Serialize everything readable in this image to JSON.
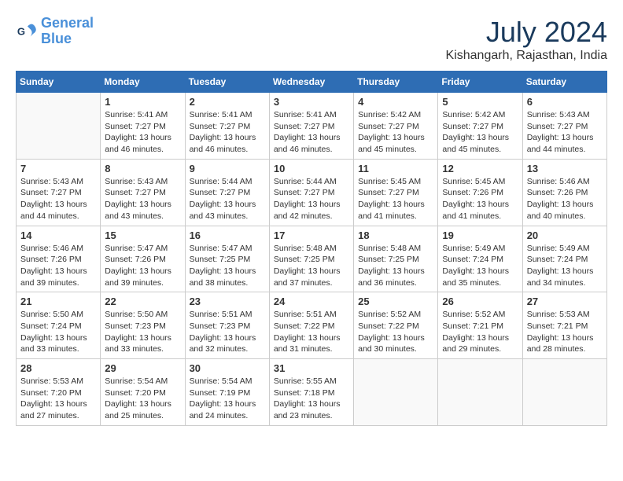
{
  "header": {
    "logo_line1": "General",
    "logo_line2": "Blue",
    "month_year": "July 2024",
    "location": "Kishangarh, Rajasthan, India"
  },
  "columns": [
    "Sunday",
    "Monday",
    "Tuesday",
    "Wednesday",
    "Thursday",
    "Friday",
    "Saturday"
  ],
  "weeks": [
    [
      {
        "day": "",
        "info": ""
      },
      {
        "day": "1",
        "info": "Sunrise: 5:41 AM\nSunset: 7:27 PM\nDaylight: 13 hours\nand 46 minutes."
      },
      {
        "day": "2",
        "info": "Sunrise: 5:41 AM\nSunset: 7:27 PM\nDaylight: 13 hours\nand 46 minutes."
      },
      {
        "day": "3",
        "info": "Sunrise: 5:41 AM\nSunset: 7:27 PM\nDaylight: 13 hours\nand 46 minutes."
      },
      {
        "day": "4",
        "info": "Sunrise: 5:42 AM\nSunset: 7:27 PM\nDaylight: 13 hours\nand 45 minutes."
      },
      {
        "day": "5",
        "info": "Sunrise: 5:42 AM\nSunset: 7:27 PM\nDaylight: 13 hours\nand 45 minutes."
      },
      {
        "day": "6",
        "info": "Sunrise: 5:43 AM\nSunset: 7:27 PM\nDaylight: 13 hours\nand 44 minutes."
      }
    ],
    [
      {
        "day": "7",
        "info": "Sunrise: 5:43 AM\nSunset: 7:27 PM\nDaylight: 13 hours\nand 44 minutes."
      },
      {
        "day": "8",
        "info": "Sunrise: 5:43 AM\nSunset: 7:27 PM\nDaylight: 13 hours\nand 43 minutes."
      },
      {
        "day": "9",
        "info": "Sunrise: 5:44 AM\nSunset: 7:27 PM\nDaylight: 13 hours\nand 43 minutes."
      },
      {
        "day": "10",
        "info": "Sunrise: 5:44 AM\nSunset: 7:27 PM\nDaylight: 13 hours\nand 42 minutes."
      },
      {
        "day": "11",
        "info": "Sunrise: 5:45 AM\nSunset: 7:27 PM\nDaylight: 13 hours\nand 41 minutes."
      },
      {
        "day": "12",
        "info": "Sunrise: 5:45 AM\nSunset: 7:26 PM\nDaylight: 13 hours\nand 41 minutes."
      },
      {
        "day": "13",
        "info": "Sunrise: 5:46 AM\nSunset: 7:26 PM\nDaylight: 13 hours\nand 40 minutes."
      }
    ],
    [
      {
        "day": "14",
        "info": "Sunrise: 5:46 AM\nSunset: 7:26 PM\nDaylight: 13 hours\nand 39 minutes."
      },
      {
        "day": "15",
        "info": "Sunrise: 5:47 AM\nSunset: 7:26 PM\nDaylight: 13 hours\nand 39 minutes."
      },
      {
        "day": "16",
        "info": "Sunrise: 5:47 AM\nSunset: 7:25 PM\nDaylight: 13 hours\nand 38 minutes."
      },
      {
        "day": "17",
        "info": "Sunrise: 5:48 AM\nSunset: 7:25 PM\nDaylight: 13 hours\nand 37 minutes."
      },
      {
        "day": "18",
        "info": "Sunrise: 5:48 AM\nSunset: 7:25 PM\nDaylight: 13 hours\nand 36 minutes."
      },
      {
        "day": "19",
        "info": "Sunrise: 5:49 AM\nSunset: 7:24 PM\nDaylight: 13 hours\nand 35 minutes."
      },
      {
        "day": "20",
        "info": "Sunrise: 5:49 AM\nSunset: 7:24 PM\nDaylight: 13 hours\nand 34 minutes."
      }
    ],
    [
      {
        "day": "21",
        "info": "Sunrise: 5:50 AM\nSunset: 7:24 PM\nDaylight: 13 hours\nand 33 minutes."
      },
      {
        "day": "22",
        "info": "Sunrise: 5:50 AM\nSunset: 7:23 PM\nDaylight: 13 hours\nand 33 minutes."
      },
      {
        "day": "23",
        "info": "Sunrise: 5:51 AM\nSunset: 7:23 PM\nDaylight: 13 hours\nand 32 minutes."
      },
      {
        "day": "24",
        "info": "Sunrise: 5:51 AM\nSunset: 7:22 PM\nDaylight: 13 hours\nand 31 minutes."
      },
      {
        "day": "25",
        "info": "Sunrise: 5:52 AM\nSunset: 7:22 PM\nDaylight: 13 hours\nand 30 minutes."
      },
      {
        "day": "26",
        "info": "Sunrise: 5:52 AM\nSunset: 7:21 PM\nDaylight: 13 hours\nand 29 minutes."
      },
      {
        "day": "27",
        "info": "Sunrise: 5:53 AM\nSunset: 7:21 PM\nDaylight: 13 hours\nand 28 minutes."
      }
    ],
    [
      {
        "day": "28",
        "info": "Sunrise: 5:53 AM\nSunset: 7:20 PM\nDaylight: 13 hours\nand 27 minutes."
      },
      {
        "day": "29",
        "info": "Sunrise: 5:54 AM\nSunset: 7:20 PM\nDaylight: 13 hours\nand 25 minutes."
      },
      {
        "day": "30",
        "info": "Sunrise: 5:54 AM\nSunset: 7:19 PM\nDaylight: 13 hours\nand 24 minutes."
      },
      {
        "day": "31",
        "info": "Sunrise: 5:55 AM\nSunset: 7:18 PM\nDaylight: 13 hours\nand 23 minutes."
      },
      {
        "day": "",
        "info": ""
      },
      {
        "day": "",
        "info": ""
      },
      {
        "day": "",
        "info": ""
      }
    ]
  ]
}
